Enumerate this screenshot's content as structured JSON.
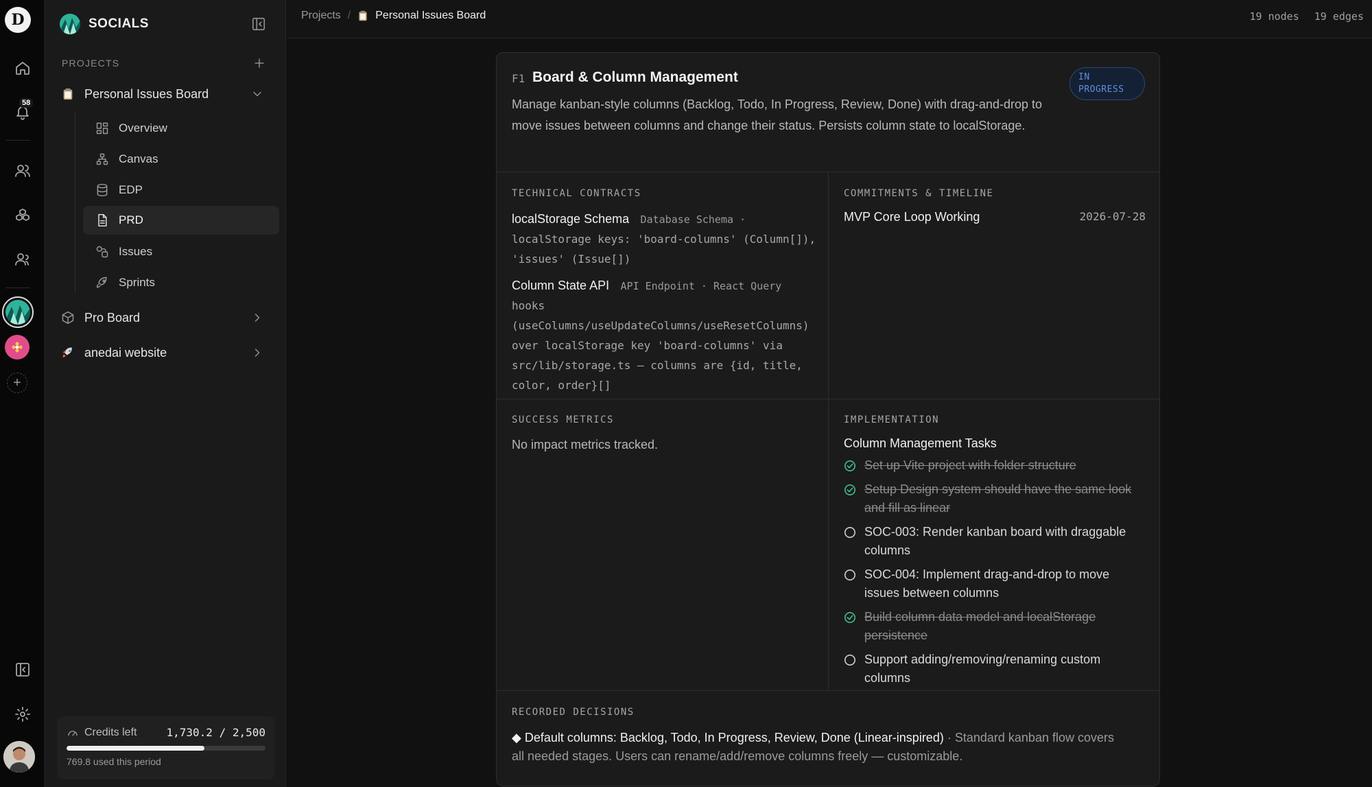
{
  "rail": {
    "logo_letter": "D",
    "notifications_count": "58"
  },
  "sidebar": {
    "workspace_name": "SOCIALS",
    "projects_label": "PROJECTS",
    "projects": [
      {
        "name": "Personal Issues Board",
        "icon": "clipboard-icon",
        "expanded": true
      },
      {
        "name": "Pro Board",
        "icon": "box-icon",
        "expanded": false
      },
      {
        "name": "anedai website",
        "icon": "rocket-icon",
        "expanded": false
      }
    ],
    "subnav": [
      {
        "label": "Overview",
        "icon": "grid-icon"
      },
      {
        "label": "Canvas",
        "icon": "nodes-icon"
      },
      {
        "label": "EDP",
        "icon": "database-icon"
      },
      {
        "label": "PRD",
        "icon": "document-icon",
        "active": true
      },
      {
        "label": "Issues",
        "icon": "issues-icon"
      },
      {
        "label": "Sprints",
        "icon": "rocket-icon"
      }
    ],
    "credits": {
      "label": "Credits left",
      "value": "1,730.2 / 2,500",
      "remaining_fraction": 0.692,
      "used_text": "769.8 used this period"
    }
  },
  "topbar": {
    "breadcrumb_root": "Projects",
    "breadcrumb_separator": "/",
    "breadcrumb_current": "Personal Issues Board",
    "nodes": "19 nodes",
    "edges": "19 edges"
  },
  "feature": {
    "id": "F1",
    "title": "Board & Column Management",
    "description": "Manage kanban-style columns (Backlog, Todo, In Progress, Review, Done) with drag-and-drop to move issues between columns and change their status. Persists column state to localStorage.",
    "status_line1": "IN",
    "status_line2": "PROGRESS",
    "status_color": "#5f8fe0"
  },
  "technical_contracts": {
    "label": "TECHNICAL CONTRACTS",
    "items": [
      {
        "name": "localStorage Schema",
        "kind": "Database Schema ·",
        "body": "localStorage keys: 'board-columns' (Column[]), 'issues' (Issue[])"
      },
      {
        "name": "Column State API",
        "kind": "API Endpoint · React Query",
        "body": "hooks (useColumns/useUpdateColumns/useResetColumns) over localStorage key 'board-columns' via src/lib/storage.ts — columns are {id, title, color, order}[]"
      }
    ]
  },
  "commitments": {
    "label": "COMMITMENTS & TIMELINE",
    "items": [
      {
        "title": "MVP Core Loop Working",
        "date": "2026-07-28"
      }
    ]
  },
  "success_metrics": {
    "label": "SUCCESS METRICS",
    "empty_text": "No impact metrics tracked."
  },
  "implementation": {
    "label": "IMPLEMENTATION",
    "group_title": "Column Management Tasks",
    "done_color": "#3fbf8a",
    "tasks": [
      {
        "text": "Set up Vite project with folder structure",
        "done": true
      },
      {
        "text": "Setup Design system should have the same look and fill as linear",
        "done": true
      },
      {
        "text": "SOC-003: Render kanban board with draggable columns",
        "done": false
      },
      {
        "text": "SOC-004: Implement drag-and-drop to move issues between columns",
        "done": false
      },
      {
        "text": "Build column data model and localStorage persistence",
        "done": true
      },
      {
        "text": "Support adding/removing/renaming custom columns",
        "done": false
      }
    ]
  },
  "decisions": {
    "label": "RECORDED DECISIONS",
    "items": [
      {
        "bullet": "◆",
        "title": "Default columns: Backlog, Todo, In Progress, Review, Done (Linear-inspired)",
        "separator": "·",
        "rationale": "Standard kanban flow covers all needed stages. Users can rename/add/remove columns freely — customizable."
      }
    ]
  }
}
